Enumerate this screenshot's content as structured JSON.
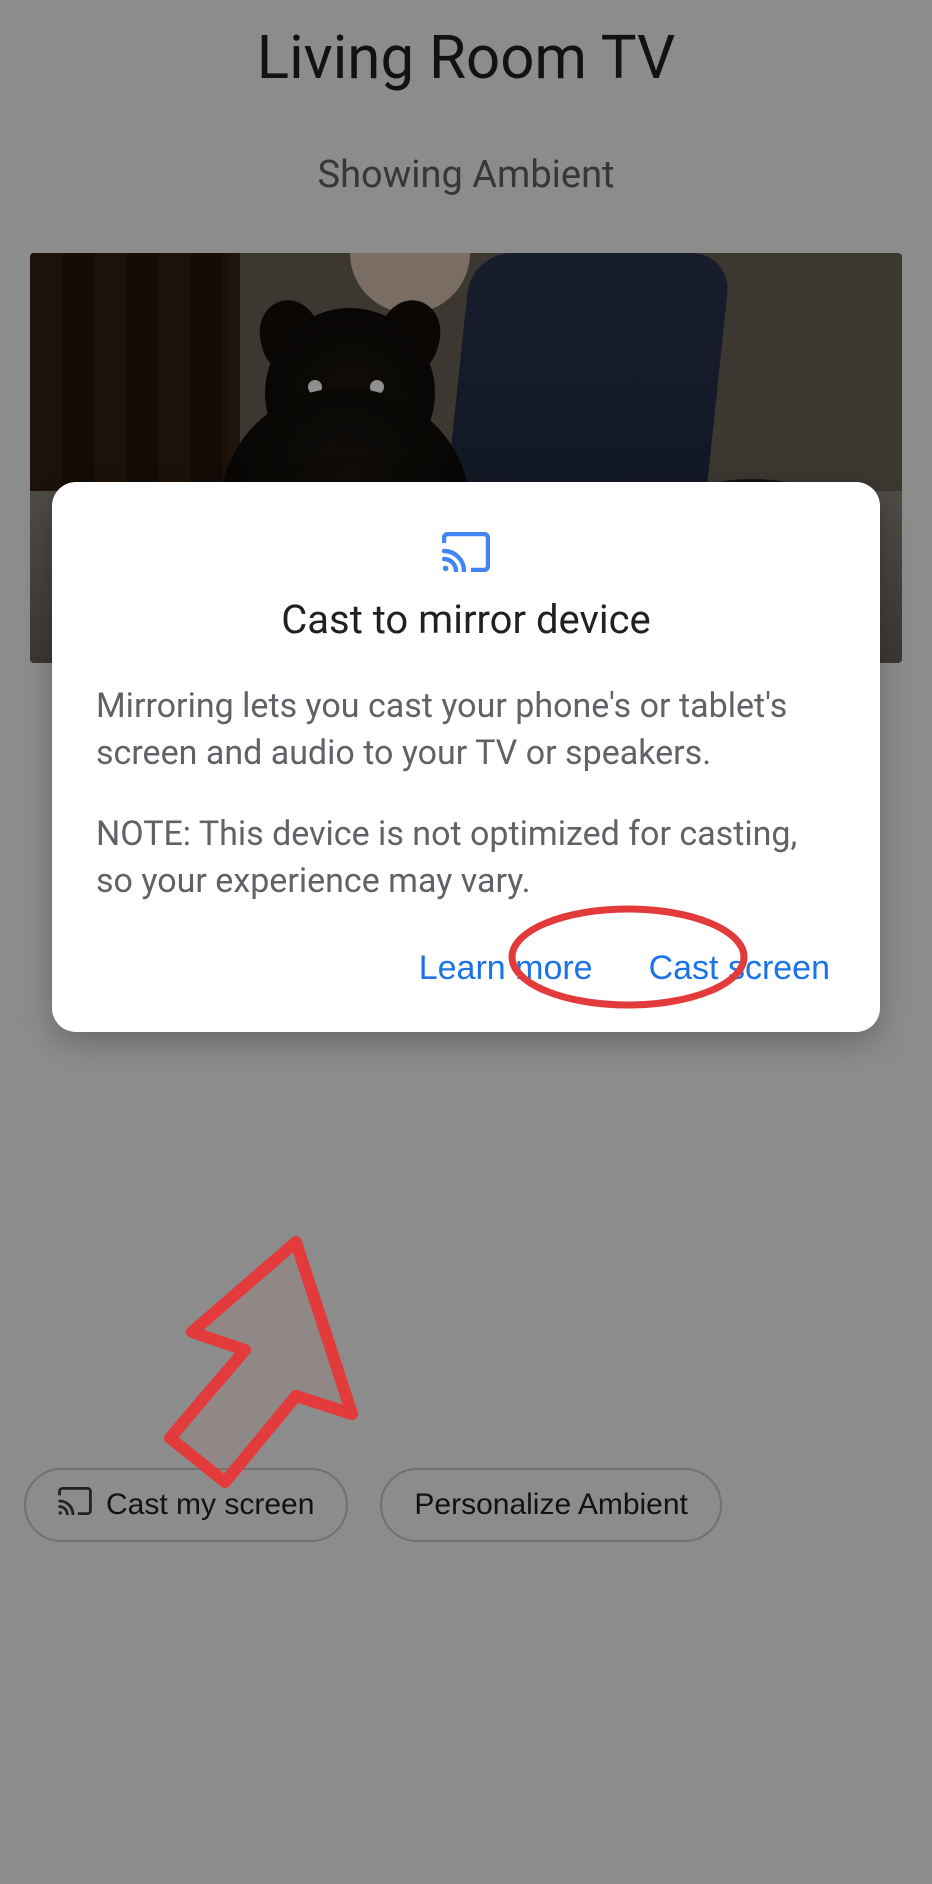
{
  "header": {
    "device_name": "Living Room TV",
    "status": "Showing Ambient"
  },
  "chips": {
    "cast_my_screen": "Cast my screen",
    "personalize_ambient": "Personalize Ambient"
  },
  "dialog": {
    "title": "Cast to mirror device",
    "body_1": "Mirroring lets you cast your phone's or tablet's screen and audio to your TV or speakers.",
    "body_2": "NOTE: This device is not optimized for casting, so your experience may vary.",
    "learn_more": "Learn more",
    "cast_screen": "Cast screen"
  },
  "colors": {
    "link": "#1a73e8",
    "annotation": "#e33b3b"
  },
  "icons": {
    "cast": "cast-icon"
  }
}
